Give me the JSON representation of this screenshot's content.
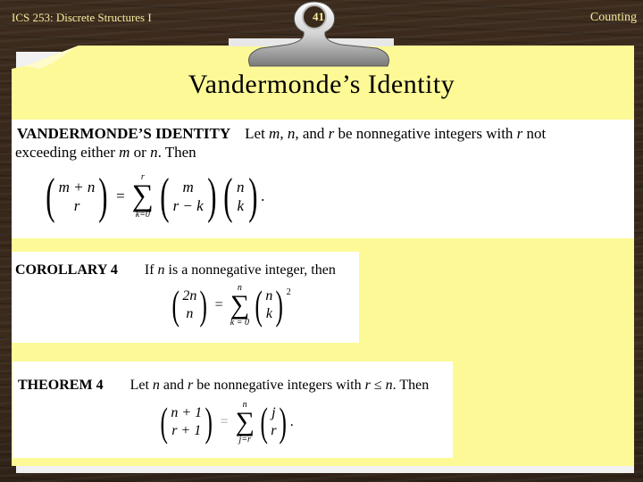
{
  "header": {
    "course": "ICS 253: Discrete Structures I",
    "topic": "Counting",
    "slide_number": "41"
  },
  "slide": {
    "title": "Vandermonde’s Identity",
    "colors": {
      "paper": "#fdf997",
      "header_text": "#f7ec9c",
      "background_wood": "#3a2a1c"
    }
  },
  "vandermonde": {
    "label": "VANDERMONDE’S IDENTITY",
    "statement_1a": "Let ",
    "m": "m",
    "comma": ", ",
    "n": "n",
    "and": ", and ",
    "r": "r",
    "statement_1b": " be nonnegative integers with ",
    "statement_1c": " not",
    "statement_2a": "exceeding either ",
    "or": " or ",
    "statement_2b": ". Then",
    "formula": {
      "lhs_top": "m + n",
      "lhs_bottom": "r",
      "equals": "=",
      "sum_upper": "r",
      "sum_lower": "k=0",
      "term1_top": "m",
      "term1_bottom": "r − k",
      "term2_top": "n",
      "term2_bottom": "k",
      "end": "."
    }
  },
  "corollary": {
    "label": "COROLLARY 4",
    "statement_a": "If ",
    "n": "n",
    "statement_b": " is a nonnegative integer, then",
    "formula": {
      "lhs_top": "2n",
      "lhs_bottom": "n",
      "equals": "=",
      "sum_upper": "n",
      "sum_lower": "k = 0",
      "term_top": "n",
      "term_bottom": "k",
      "exponent": "2"
    }
  },
  "theorem": {
    "label": "THEOREM 4",
    "statement_a": "Let ",
    "n": "n",
    "statement_b": " and ",
    "r": "r",
    "statement_c": " be nonnegative integers with ",
    "leq": " ≤ ",
    "statement_d": ". Then",
    "formula": {
      "lhs_top": "n + 1",
      "lhs_bottom": "r + 1",
      "equals": "=",
      "sum_upper": "n",
      "sum_lower": "j=r",
      "term_top": "j",
      "term_bottom": "r",
      "end": "."
    }
  }
}
